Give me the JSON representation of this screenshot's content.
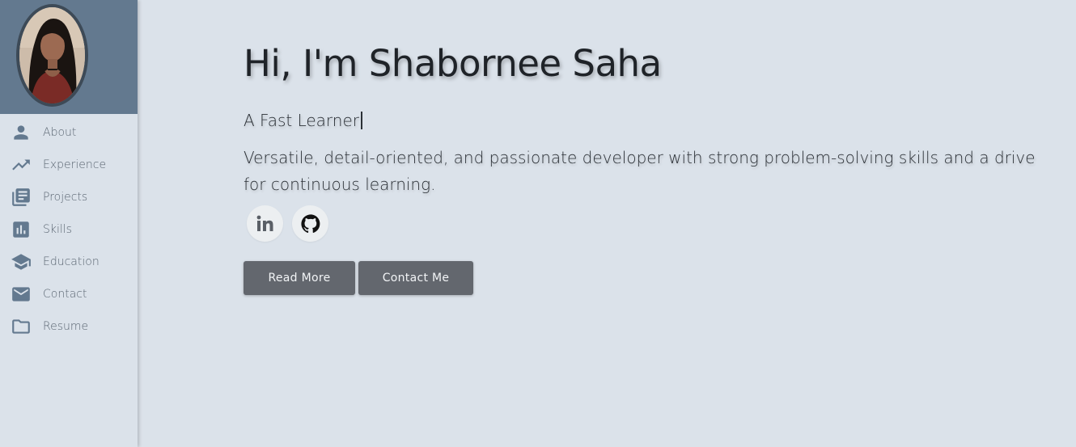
{
  "profile": {
    "avatar_alt": "Profile photo"
  },
  "sidebar": {
    "items": [
      {
        "label": "About",
        "icon": "person-icon"
      },
      {
        "label": "Experience",
        "icon": "trending-up-icon"
      },
      {
        "label": "Projects",
        "icon": "library-books-icon"
      },
      {
        "label": "Skills",
        "icon": "bar-chart-icon"
      },
      {
        "label": "Education",
        "icon": "graduation-cap-icon"
      },
      {
        "label": "Contact",
        "icon": "mail-icon"
      },
      {
        "label": "Resume",
        "icon": "folder-icon"
      }
    ]
  },
  "hero": {
    "title": "Hi, I'm Shabornee Saha",
    "tagline": "A Fast Learner",
    "description": "Versatile, detail-oriented, and passionate developer with strong problem-solving skills and a drive for continuous learning."
  },
  "socials": [
    {
      "name": "LinkedIn",
      "icon": "linkedin-icon"
    },
    {
      "name": "GitHub",
      "icon": "github-icon"
    }
  ],
  "actions": {
    "read_more_label": "Read More",
    "contact_label": "Contact Me"
  },
  "colors": {
    "background": "#dbe2ea",
    "accent": "#63798f",
    "button": "#63676e"
  }
}
